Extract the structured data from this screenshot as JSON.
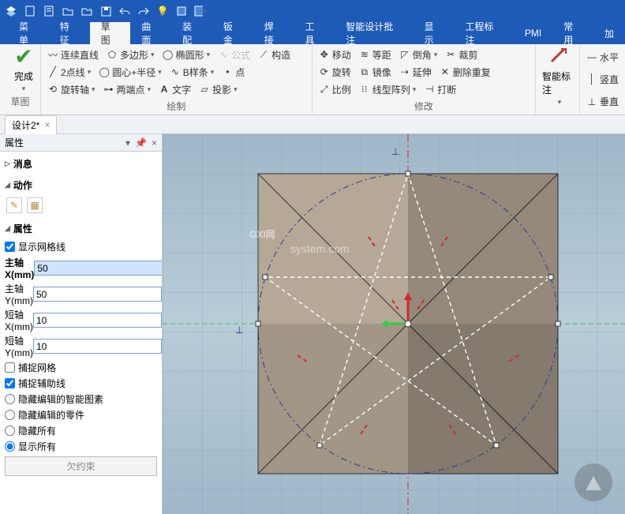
{
  "titlebar_icons": [
    "app",
    "new",
    "open",
    "open2",
    "folder",
    "save",
    "undo",
    "redo",
    "light",
    "layers",
    "star"
  ],
  "menubar": {
    "items": [
      "菜单",
      "特征",
      "草图",
      "曲面",
      "装配",
      "钣金",
      "焊接",
      "工具",
      "智能设计批注",
      "显示",
      "工程标注",
      "PMI",
      "常用",
      "加"
    ],
    "active": 2
  },
  "ribbon": {
    "finish": {
      "label": "完成",
      "group": "草图"
    },
    "draw": {
      "group": "绘制",
      "r1": [
        {
          "t": "连续直线"
        },
        {
          "t": "多边形",
          "dd": true
        },
        {
          "t": "椭圆形",
          "dd": true
        },
        {
          "t": "公式",
          "dim": true
        },
        {
          "t": "构造"
        }
      ],
      "r2": [
        {
          "t": "2点线",
          "dd": true
        },
        {
          "t": "圆心+半径",
          "dd": true
        },
        {
          "t": "B样条",
          "dd": true
        },
        {
          "t": "点"
        }
      ],
      "r3": [
        {
          "t": "旋转轴",
          "dd": true
        },
        {
          "t": "两端点",
          "dd": true
        },
        {
          "t": "文字"
        },
        {
          "t": "投影",
          "dd": true
        }
      ]
    },
    "modify": {
      "group": "修改",
      "r1": [
        {
          "t": "移动"
        },
        {
          "t": "等距"
        },
        {
          "t": "倒角",
          "dd": true
        },
        {
          "t": "裁剪"
        }
      ],
      "r2": [
        {
          "t": "旋转"
        },
        {
          "t": "镜像"
        },
        {
          "t": "延伸"
        },
        {
          "t": "删除重复"
        }
      ],
      "r3": [
        {
          "t": "比例"
        },
        {
          "t": "线型阵列",
          "dd": true
        },
        {
          "t": "打断"
        }
      ]
    },
    "smart": {
      "label": "智能标注"
    },
    "constr": {
      "r1": "水平",
      "r2": "竖直",
      "r3": "垂直"
    }
  },
  "doctab": {
    "label": "设计2*",
    "close": "×"
  },
  "props": {
    "title": "属性",
    "s_msg": "消息",
    "s_action": "动作",
    "s_props": "属性",
    "show_grid": "显示网格线",
    "fields": [
      {
        "label": "主轴X(mm)",
        "value": "50",
        "sel": true
      },
      {
        "label": "主轴Y(mm)",
        "value": "50"
      },
      {
        "label": "短轴X(mm)",
        "value": "10"
      },
      {
        "label": "短轴Y(mm)",
        "value": "10"
      }
    ],
    "snap_grid": "捕捉网格",
    "snap_guide": "捕捉辅助线",
    "radios": [
      {
        "t": "隐藏编辑的智能图素"
      },
      {
        "t": "隐藏编辑的零件"
      },
      {
        "t": "隐藏所有"
      },
      {
        "t": "显示所有"
      }
    ],
    "btn": "欠约束"
  },
  "watermark": {
    "big": "GXI网",
    "small": "system.com"
  }
}
